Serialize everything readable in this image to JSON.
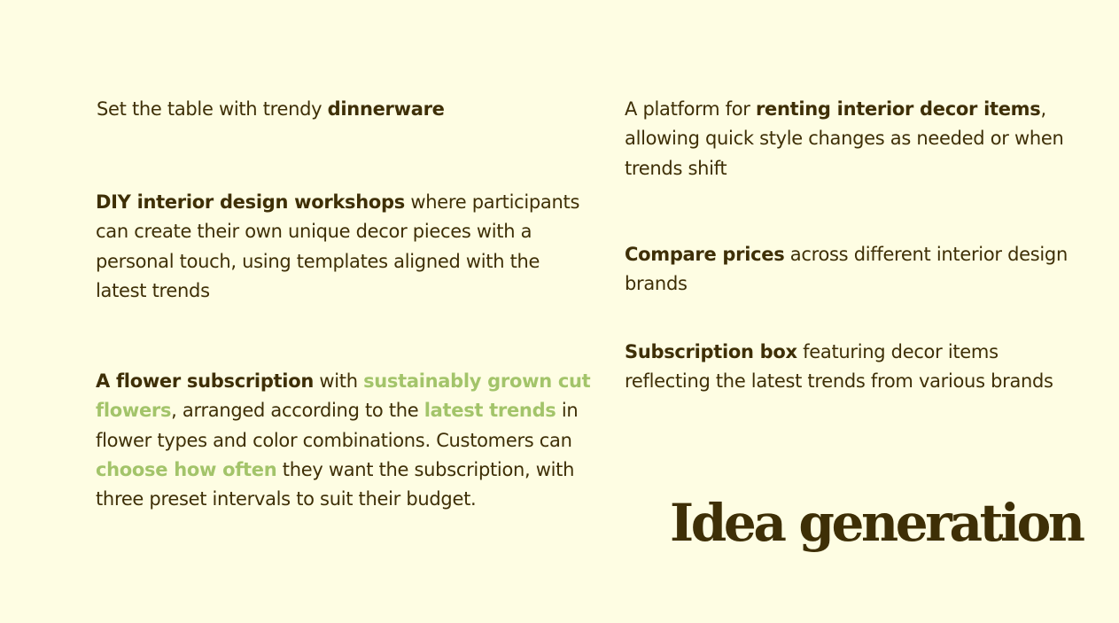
{
  "slide": {
    "title": "Idea generation",
    "colors": {
      "background": "#fefde3",
      "text": "#3e2f06",
      "highlight": "#a3c46a"
    }
  },
  "ideas": [
    {
      "segments": [
        {
          "text": "Set the table with trendy ",
          "style": "normal"
        },
        {
          "text": "dinnerware",
          "style": "bold"
        }
      ]
    },
    {
      "segments": [
        {
          "text": "DIY interior design workshops",
          "style": "bold"
        },
        {
          "text": " where participants can create their own unique decor pieces with a personal touch, using templates aligned with the latest trends",
          "style": "normal"
        }
      ]
    },
    {
      "segments": [
        {
          "text": "A flower subscription",
          "style": "bold"
        },
        {
          "text": " with ",
          "style": "normal"
        },
        {
          "text": "sustainably grown cut flowers",
          "style": "highlight"
        },
        {
          "text": ", arranged according to the ",
          "style": "normal"
        },
        {
          "text": "latest trends",
          "style": "highlight"
        },
        {
          "text": " in flower types and color combinations. Customers can ",
          "style": "normal"
        },
        {
          "text": "choose how often",
          "style": "highlight"
        },
        {
          "text": " they want the subscription, with three preset intervals to suit their budget.",
          "style": "normal"
        }
      ]
    },
    {
      "segments": [
        {
          "text": "A platform for ",
          "style": "normal"
        },
        {
          "text": "renting interior decor items",
          "style": "bold"
        },
        {
          "text": ", allowing quick style changes as needed or when trends shift",
          "style": "normal"
        }
      ]
    },
    {
      "segments": [
        {
          "text": "Compare prices",
          "style": "bold"
        },
        {
          "text": " across different interior design brands",
          "style": "normal"
        }
      ]
    },
    {
      "segments": [
        {
          "text": "Subscription box",
          "style": "bold"
        },
        {
          "text": " featuring decor items reflecting the latest trends from various brands",
          "style": "normal"
        }
      ]
    }
  ]
}
